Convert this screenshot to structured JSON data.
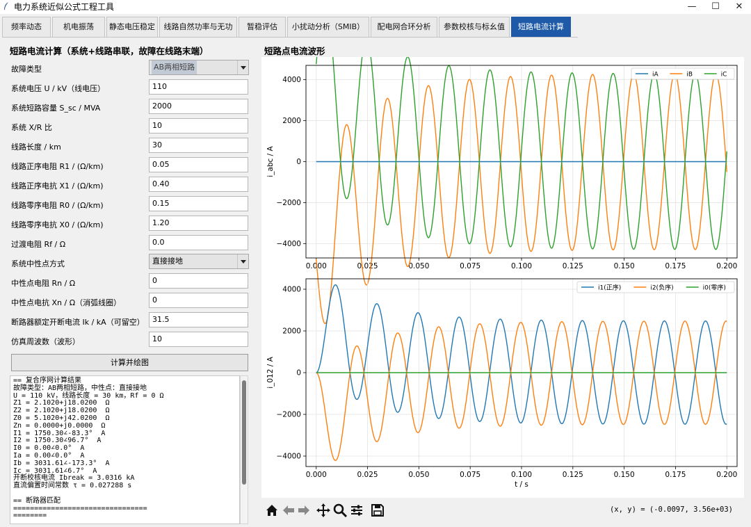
{
  "window": {
    "title": "电力系统近似公式工程工具",
    "minimize": "—",
    "maximize": "☐",
    "close": "✕"
  },
  "tabs": [
    {
      "label": "频率动态",
      "active": false
    },
    {
      "label": "机电振荡",
      "active": false
    },
    {
      "label": "静态电压稳定",
      "active": false
    },
    {
      "label": "线路自然功率与无功",
      "active": false
    },
    {
      "label": "暂稳评估",
      "active": false
    },
    {
      "label": "小扰动分析（SMIB）",
      "active": false
    },
    {
      "label": "配电网合环分析",
      "active": false
    },
    {
      "label": "参数校核与标幺值",
      "active": false
    },
    {
      "label": "短路电流计算",
      "active": true
    }
  ],
  "form": {
    "title": "短路电流计算（系统+线路串联，故障在线路末端）",
    "fault_type": {
      "label": "故障类型",
      "value": "AB两相短路"
    },
    "fields": [
      {
        "label": "系统电压 U / kV（线电压）",
        "value": "110"
      },
      {
        "label": "系统短路容量 S_sc / MVA",
        "value": "2000"
      },
      {
        "label": "系统 X/R 比",
        "value": "10"
      },
      {
        "label": "线路长度 / km",
        "value": "30"
      },
      {
        "label": "线路正序电阻 R1 / (Ω/km)",
        "value": "0.05"
      },
      {
        "label": "线路正序电抗 X1 / (Ω/km)",
        "value": "0.40"
      },
      {
        "label": "线路零序电阻 R0 / (Ω/km)",
        "value": "0.15"
      },
      {
        "label": "线路零序电抗 X0 / (Ω/km)",
        "value": "1.20"
      },
      {
        "label": "过渡电阻 Rf / Ω",
        "value": "0.0"
      }
    ],
    "neutral_mode": {
      "label": "系统中性点方式",
      "value": "直接接地"
    },
    "fields2": [
      {
        "label": "中性点电阻 Rn / Ω",
        "value": "0"
      },
      {
        "label": "中性点电抗 Xn / Ω（消弧线圈）",
        "value": "0"
      },
      {
        "label": "断路器额定开断电流 Ik / kA（可留空）",
        "value": "31.5"
      },
      {
        "label": "仿真周波数（波形）",
        "value": "10"
      }
    ],
    "calc_button": "计算并绘图"
  },
  "results": {
    "lines": [
      "== 复合序网计算结果",
      "故障类型：AB两相短路，中性点：直接接地",
      "U = 110 kV，线路长度 = 30 km，Rf = 0 Ω",
      "Z1 = 2.1020+j18.0200  Ω",
      "Z2 = 2.1020+j18.0200  Ω",
      "Z0 = 5.1020+j42.0200  Ω",
      "Zn = 0.0000+j0.0000  Ω",
      "I1 = 1750.30∠-83.3°  A",
      "I2 = 1750.30∠96.7°  A",
      "I0 = 0.00∠0.0°  A",
      "Ia = 0.00∠0.0°  A",
      "Ib = 3031.61∠-173.3°  A",
      "Ic = 3031.61∠6.7°  A",
      "开断校核电流 Ibreak = 3.0316 kA",
      "直流偏置时间常数 τ = 0.027288 s",
      "",
      "== 断路器匹配",
      "================================",
      "========"
    ]
  },
  "plot": {
    "title": "短路点电流波形",
    "coords_readout": "(x, y) = (-0.0097, 3.56e+03)"
  },
  "toolbar": {
    "icons": [
      "home-icon",
      "back-arrow-icon",
      "forward-arrow-icon",
      "pan-icon",
      "zoom-icon",
      "configure-icon",
      "save-icon"
    ]
  },
  "chart_data": [
    {
      "type": "line",
      "title": "",
      "xlabel": "",
      "ylabel": "i_abc / A",
      "xlim": [
        -0.005,
        0.205
      ],
      "ylim": [
        -4700,
        4700
      ],
      "xticks": [
        0,
        0.025,
        0.05,
        0.075,
        0.1,
        0.125,
        0.15,
        0.175,
        0.2
      ],
      "xtick_labels": [
        "0.000",
        "0.025",
        "0.050",
        "0.075",
        "0.100",
        "0.125",
        "0.150",
        "0.175",
        "0.200"
      ],
      "yticks": [
        -4000,
        -2000,
        0,
        2000,
        4000
      ],
      "grid": true,
      "legend": "top-right",
      "series": [
        {
          "name": "iA",
          "color": "#1f77b4",
          "amplitude": 0,
          "angle_deg": 0,
          "dc_offset": 0
        },
        {
          "name": "iB",
          "color": "#ff7f0e",
          "amplitude": 4287,
          "angle_deg": -173.3,
          "dc_offset_peak": -4259,
          "tau_s": 0.027288,
          "freq_hz": 50
        },
        {
          "name": "iC",
          "color": "#2ca02c",
          "amplitude": 4287,
          "angle_deg": 6.7,
          "dc_offset_peak": 4259,
          "tau_s": 0.027288,
          "freq_hz": 50
        }
      ]
    },
    {
      "type": "line",
      "title": "",
      "xlabel": "t / s",
      "ylabel": "i_012 / A",
      "xlim": [
        -0.005,
        0.205
      ],
      "ylim": [
        -4500,
        4500
      ],
      "xticks": [
        0,
        0.025,
        0.05,
        0.075,
        0.1,
        0.125,
        0.15,
        0.175,
        0.2
      ],
      "xtick_labels": [
        "0.000",
        "0.025",
        "0.050",
        "0.075",
        "0.100",
        "0.125",
        "0.150",
        "0.175",
        "0.200"
      ],
      "yticks": [
        -4000,
        -2000,
        0,
        2000,
        4000
      ],
      "grid": true,
      "legend": "top-right",
      "series": [
        {
          "name": "i1(正序)",
          "color": "#1f77b4",
          "amplitude": 2475,
          "angle_deg": -83.3,
          "dc_offset_peak": 2458,
          "tau_s": 0.027288,
          "freq_hz": 50
        },
        {
          "name": "i2(负序)",
          "color": "#ff7f0e",
          "amplitude": 2475,
          "angle_deg": 96.7,
          "dc_offset_peak": -2458,
          "tau_s": 0.027288,
          "freq_hz": 50
        },
        {
          "name": "i0(零序)",
          "color": "#2ca02c",
          "amplitude": 0,
          "angle_deg": 0,
          "dc_offset": 0
        }
      ]
    }
  ]
}
